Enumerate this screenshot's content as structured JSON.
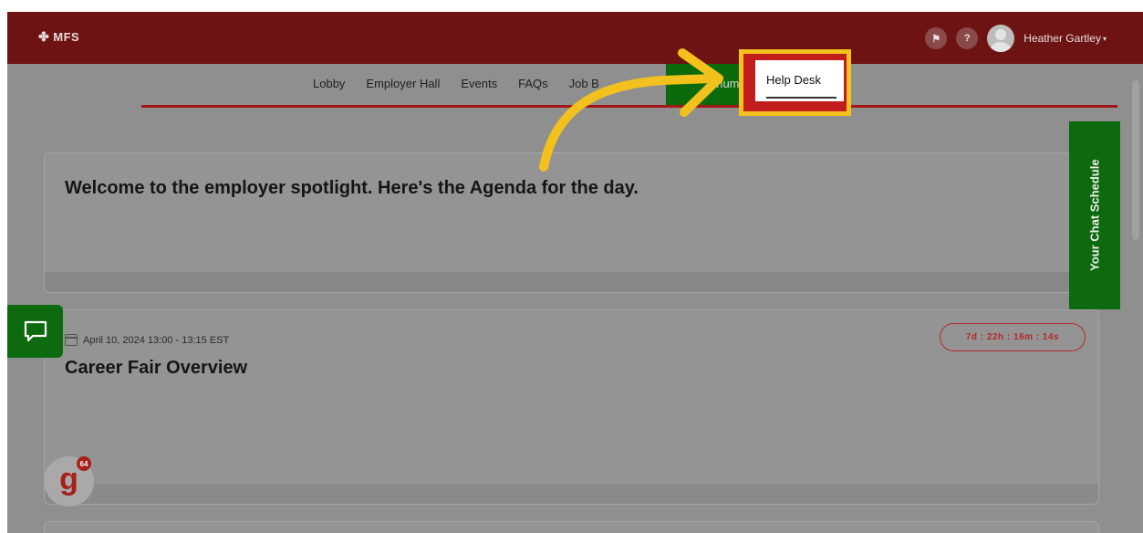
{
  "header": {
    "logo_text": "MFS",
    "user_name": "Heather Gartley",
    "help_label": "?",
    "caret": "▾"
  },
  "nav": {
    "items": [
      "Lobby",
      "Employer Hall",
      "Events",
      "FAQs",
      "Job B"
    ],
    "partial_item": "orium",
    "active_item": "Help Desk"
  },
  "welcome": {
    "text": "Welcome to the employer spotlight. Here's the Agenda for the day."
  },
  "event": {
    "date": "April 10, 2024 13:00 - 13:15 EST",
    "title": "Career Fair Overview",
    "countdown": "7d : 22h : 16m : 14s"
  },
  "chat_schedule": {
    "label": "Your Chat Schedule"
  },
  "g_badge": {
    "letter": "g",
    "count": "64"
  },
  "colors": {
    "header_bg": "#6e1313",
    "accent_green": "#0e6a0e",
    "highlight_box": "#f2c11d",
    "accent_red": "#a51717"
  },
  "icons": [
    "flag-icon",
    "help-icon",
    "user-avatar",
    "calendar-icon",
    "chat-bubble-icon",
    "arrow-annotation-icon"
  ]
}
